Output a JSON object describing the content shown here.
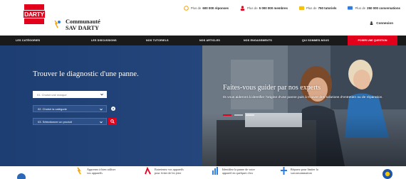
{
  "stats": [
    {
      "prefix": "Plus de",
      "value": "600 000 réponses",
      "suffix": "",
      "icon": "clock-icon",
      "color": "#f5a100"
    },
    {
      "prefix": "Plus de",
      "value": "5 000 000 membres",
      "suffix": "",
      "icon": "member-icon",
      "color": "#e3001b"
    },
    {
      "prefix": "Plus de",
      "value": "750 tutoriels",
      "suffix": "",
      "icon": "tutorial-icon",
      "color": "#f5c400"
    },
    {
      "prefix": "Plus de",
      "value": "250 000 conversations",
      "suffix": "",
      "icon": "conversation-icon",
      "color": "#2f7de1"
    }
  ],
  "header": {
    "logo_text": "DARTY",
    "brand_line1": "Communauté",
    "brand_line2": "SAV DARTY",
    "login_label": "Connexion"
  },
  "nav": {
    "items": [
      "LES CATÉGORIES",
      "LES DISCUSSIONS",
      "NOS TUTORIELS",
      "NOS ARTICLES",
      "NOS ENGAGEMENTS",
      "QUI SOMMES-NOUS"
    ],
    "cta": "POSER UNE QUESTION"
  },
  "hero": {
    "title": "Trouver le diagnostic d'une panne.",
    "select_brand": "01. Choisir une marque",
    "select_category": "02. Choisir la catégorie",
    "select_product": "03. Sélectionner un produit",
    "slide_heading": "Faites-vous guider par nos experts",
    "slide_text": "Ils vous aideront à identifier l'origine d'une panne puis à trouver des solutions d'entretien ou de réparation."
  },
  "features": [
    {
      "line1": "Apprenez à bien utiliser",
      "line2": "vos appareils",
      "icon": "bulb-icon",
      "color": "#f5a100"
    },
    {
      "line1": "Entretenez vos appareils",
      "line2": "pour éviter de les jeter",
      "icon": "chart-icon",
      "color": "#e3001b"
    },
    {
      "line1": "Identifiez la panne de votre",
      "line2": "appareil en quelques clics",
      "icon": "bars-icon",
      "color": "#2f7de1"
    },
    {
      "line1": "Réparez pour limiter la",
      "line2": "surconsommation",
      "icon": "plus-icon",
      "color": "#2f7de1"
    }
  ],
  "colors": {
    "accent": "#e3001b",
    "hero_blue": "#1c3e70",
    "nav_bg": "#1a1a1a"
  }
}
